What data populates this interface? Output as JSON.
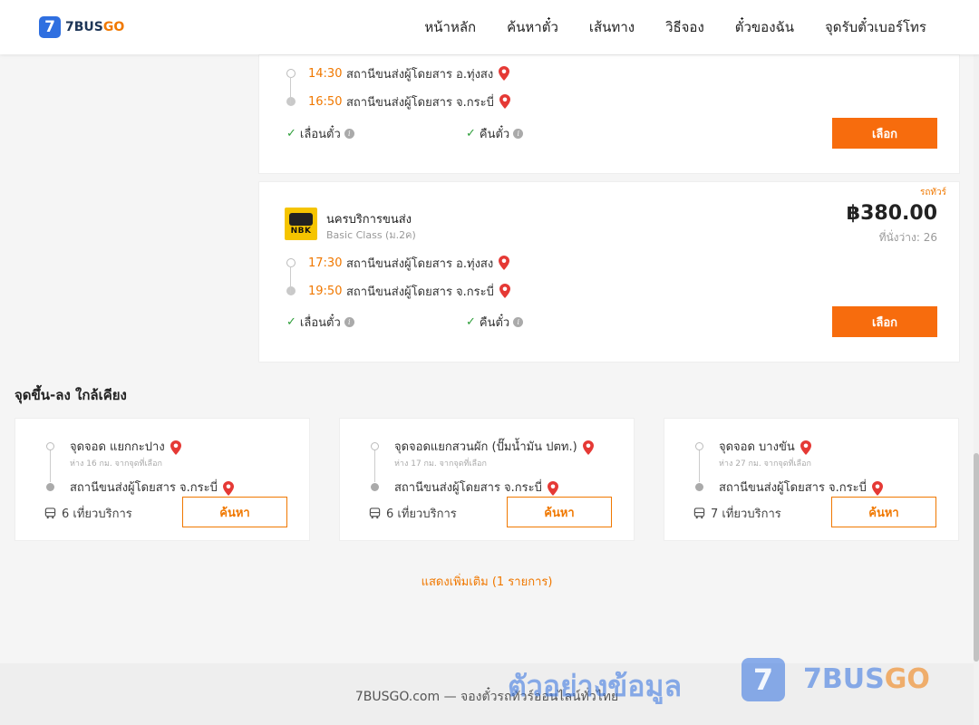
{
  "colors": {
    "accent": "#f07800",
    "brand_blue": "#2f6fe0",
    "button_orange": "#f76c0d",
    "check_green": "#2e9e3a"
  },
  "header": {
    "logo_mark": "7",
    "logo_text_part1": "7BUS",
    "logo_text_part2": "GO",
    "nav": [
      "หน้าหลัก",
      "ค้นหาตั๋ว",
      "เส้นทาง",
      "วิธีจอง",
      "ตั๋วของฉัน",
      "จุดรับตั๋วเบอร์โทร"
    ]
  },
  "trips": [
    {
      "departure_time": "14:30",
      "departure_station": "สถานีขนส่งผู้โดยสาร อ.ทุ่งสง",
      "arrival_time": "16:50",
      "arrival_station": "สถานีขนส่งผู้โดยสาร จ.กระบี่",
      "feature_1": "เลื่อนตั๋ว",
      "feature_2": "คืนตั๋ว",
      "select_label": "เลือก"
    },
    {
      "tag": "รถทัวร์",
      "operator_logo_text": "NBK",
      "operator_name": "นครบริการขนส่ง",
      "class_name": "Basic Class (ม.2ค)",
      "price": "฿380.00",
      "seats": "ที่นั่งว่าง: 26",
      "departure_time": "17:30",
      "departure_station": "สถานีขนส่งผู้โดยสาร อ.ทุ่งสง",
      "arrival_time": "19:50",
      "arrival_station": "สถานีขนส่งผู้โดยสาร จ.กระบี่",
      "feature_1": "เลื่อนตั๋ว",
      "feature_2": "คืนตั๋ว",
      "select_label": "เลือก"
    }
  ],
  "nearby": {
    "title": "จุดขึ้น-ลง ใกล้เคียง",
    "items": [
      {
        "from": "จุดจอด แยกกะปาง",
        "distance": "ห่าง 16 กม. จากจุดที่เลือก",
        "to": "สถานีขนส่งผู้โดยสาร จ.กระบี่",
        "trips": "6 เที่ยวบริการ",
        "search_label": "ค้นหา"
      },
      {
        "from": "จุดจอดแยกสวนผัก (ปั๊มน้ำมัน ปตท.)",
        "distance": "ห่าง 17 กม. จากจุดที่เลือก",
        "to": "สถานีขนส่งผู้โดยสาร จ.กระบี่",
        "trips": "6 เที่ยวบริการ",
        "search_label": "ค้นหา"
      },
      {
        "from": "จุดจอด บางขัน",
        "distance": "ห่าง 27 กม. จากจุดที่เลือก",
        "to": "สถานีขนส่งผู้โดยสาร จ.กระบี่",
        "trips": "7 เที่ยวบริการ",
        "search_label": "ค้นหา"
      }
    ],
    "show_more": "แสดงเพิ่มเติม (1 รายการ)"
  },
  "footer": {
    "text": "7BUSGO.com — จองตั๋วรถทัวร์ออนไลน์ทั่วไทย",
    "watermark_text": "ตัวอย่างข้อมูล",
    "watermark_logo_mark": "7",
    "watermark_brand_part1": "7BUS",
    "watermark_brand_part2": "GO"
  }
}
